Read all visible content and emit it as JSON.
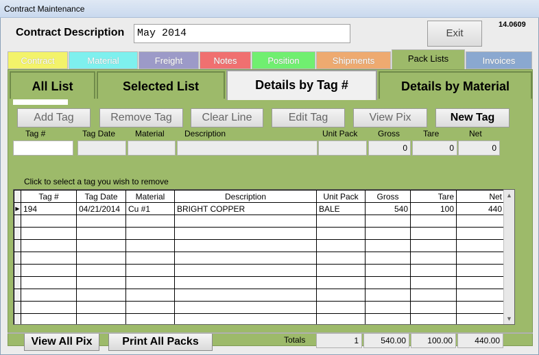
{
  "window": {
    "title": "Contract Maintenance"
  },
  "header": {
    "desc_label": "Contract Description",
    "desc_value": "May 2014",
    "exit_label": "Exit",
    "version": "14.0609"
  },
  "tabs": [
    {
      "label": "Contract",
      "color": "#f3f36a",
      "active": false
    },
    {
      "label": "Material",
      "color": "#7ef0ee",
      "active": false
    },
    {
      "label": "Freight",
      "color": "#9c9ac8",
      "active": false
    },
    {
      "label": "Notes",
      "color": "#f07070",
      "active": false
    },
    {
      "label": "Position",
      "color": "#70ef70",
      "active": false
    },
    {
      "label": "Shipments",
      "color": "#eeaa70",
      "active": false
    },
    {
      "label": "Pack Lists",
      "color": "#9dba6a",
      "active": true
    },
    {
      "label": "Invoices",
      "color": "#8aa8d0",
      "active": false
    }
  ],
  "subtabs": [
    {
      "label": "All List"
    },
    {
      "label": "Selected List"
    },
    {
      "label": "Details by Tag #"
    },
    {
      "label": "Details by Material"
    }
  ],
  "actions": {
    "add_tag": "Add Tag",
    "remove_tag": "Remove Tag",
    "clear_line": "Clear Line",
    "edit_tag": "Edit Tag",
    "view_pix": "View Pix",
    "new_tag": "New Tag"
  },
  "entry": {
    "labels": {
      "tag": "Tag #",
      "tag_date": "Tag Date",
      "material": "Material",
      "description": "Description",
      "unit_pack": "Unit Pack",
      "gross": "Gross",
      "tare": "Tare",
      "net": "Net"
    },
    "values": {
      "gross": "0",
      "tare": "0",
      "net": "0"
    }
  },
  "hint": "Click to select a tag you wish to remove",
  "grid": {
    "columns": [
      "Tag #",
      "Tag Date",
      "Material",
      "Description",
      "Unit Pack",
      "Gross",
      "Tare",
      "Net"
    ],
    "rows": [
      {
        "tag": "194",
        "tag_date": "04/21/2014",
        "material": "Cu #1",
        "description": "BRIGHT COPPER",
        "unit_pack": "BALE",
        "gross": "540",
        "tare": "100",
        "net": "440"
      }
    ],
    "scroll_up": "▲",
    "scroll_down": "▼"
  },
  "bottom": {
    "view_all_pix": "View All Pix",
    "print_all_packs": "Print All Packs",
    "totals_label": "Totals",
    "totals": {
      "count": "1",
      "gross": "540.00",
      "tare": "100.00",
      "net": "440.00"
    }
  }
}
